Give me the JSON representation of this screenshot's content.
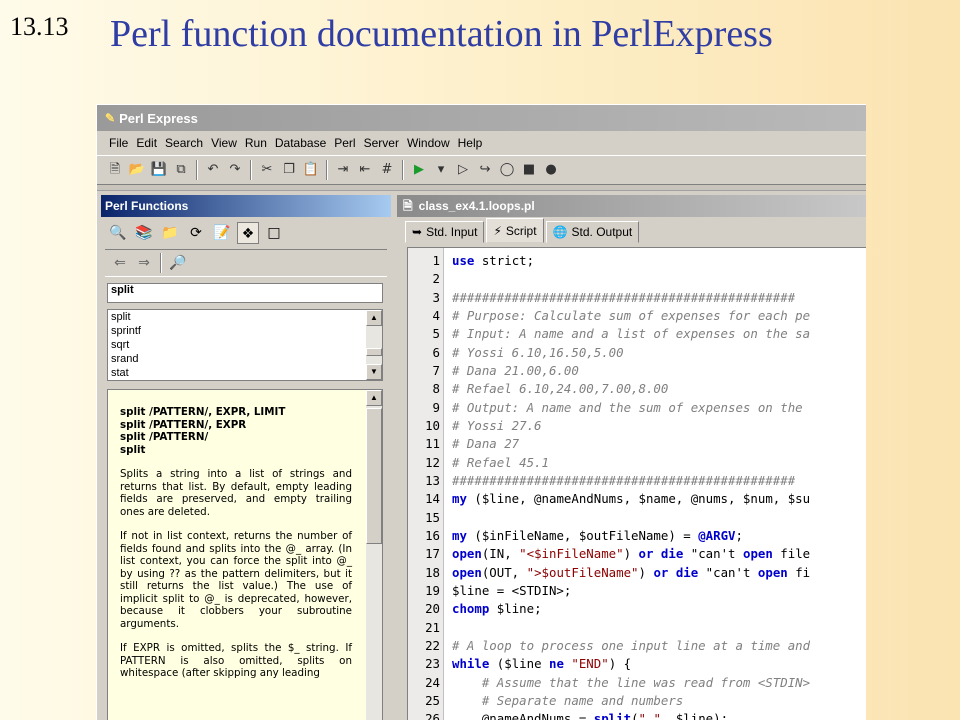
{
  "slide": {
    "number": "13.13",
    "title": "Perl function documentation in PerlExpress"
  },
  "app": {
    "title": "Perl Express",
    "menu": [
      "File",
      "Edit",
      "Search",
      "View",
      "Run",
      "Database",
      "Perl",
      "Server",
      "Window",
      "Help"
    ]
  },
  "perl_functions": {
    "panel_title": "Perl Functions",
    "search_value": "split",
    "list_items": [
      "split",
      "sprintf",
      "sqrt",
      "srand",
      "stat"
    ],
    "doc": {
      "synopsis": [
        "split /PATTERN/, EXPR, LIMIT",
        "split /PATTERN/, EXPR",
        "split /PATTERN/",
        "split"
      ],
      "paragraphs": [
        "Splits a string into a list of strings and returns that list. By default, empty leading fields are preserved, and empty trailing ones are deleted.",
        "If not in list context, returns the number of fields found and splits into the @_ array. (In list context, you can force the split into @_ by using ?? as the pattern delimiters, but it still returns the list value.) The use of implicit split to @_ is deprecated, however, because it clobbers your subroutine arguments.",
        "If EXPR is omitted, splits the $_ string. If PATTERN is also omitted, splits on whitespace (after skipping any leading"
      ]
    }
  },
  "editor": {
    "file_name": "class_ex4.1.loops.pl",
    "tabs": [
      "Std. Input",
      "Script",
      "Std. Output"
    ],
    "active_tab": "Script",
    "lines": [
      {
        "n": "1",
        "code": "use strict;"
      },
      {
        "n": "2",
        "code": ""
      },
      {
        "n": "3",
        "code": "##############################################"
      },
      {
        "n": "4",
        "code": "# Purpose: Calculate sum of expenses for each pe"
      },
      {
        "n": "5",
        "code": "# Input: A name and a list of expenses on the sa"
      },
      {
        "n": "6",
        "code": "# Yossi 6.10,16.50,5.00"
      },
      {
        "n": "7",
        "code": "# Dana 21.00,6.00"
      },
      {
        "n": "8",
        "code": "# Refael 6.10,24.00,7.00,8.00"
      },
      {
        "n": "9",
        "code": "# Output: A name and the sum of expenses on the"
      },
      {
        "n": "10",
        "code": "# Yossi 27.6"
      },
      {
        "n": "11",
        "code": "# Dana 27"
      },
      {
        "n": "12",
        "code": "# Refael 45.1"
      },
      {
        "n": "13",
        "code": "##############################################"
      },
      {
        "n": "14",
        "code": "my ($line, @nameAndNums, $name, @nums, $num, $su"
      },
      {
        "n": "15",
        "code": ""
      },
      {
        "n": "16",
        "code": "my ($inFileName, $outFileName) = @ARGV;"
      },
      {
        "n": "17",
        "code": "open(IN, \"<$inFileName\") or die \"can't open file"
      },
      {
        "n": "18",
        "code": "open(OUT, \">$outFileName\") or die \"can't open fi"
      },
      {
        "n": "19",
        "code": "$line = <STDIN>;"
      },
      {
        "n": "20",
        "code": "chomp $line;"
      },
      {
        "n": "21",
        "code": ""
      },
      {
        "n": "22",
        "code": "# A loop to process one input line at a time and"
      },
      {
        "n": "23",
        "code": "while ($line ne \"END\") {"
      },
      {
        "n": "24",
        "code": "    # Assume that the line was read from <STDIN>"
      },
      {
        "n": "25",
        "code": "    # Separate name and numbers"
      },
      {
        "n": "26",
        "code": "    @nameAndNums = split(\" \", $line);"
      }
    ]
  }
}
